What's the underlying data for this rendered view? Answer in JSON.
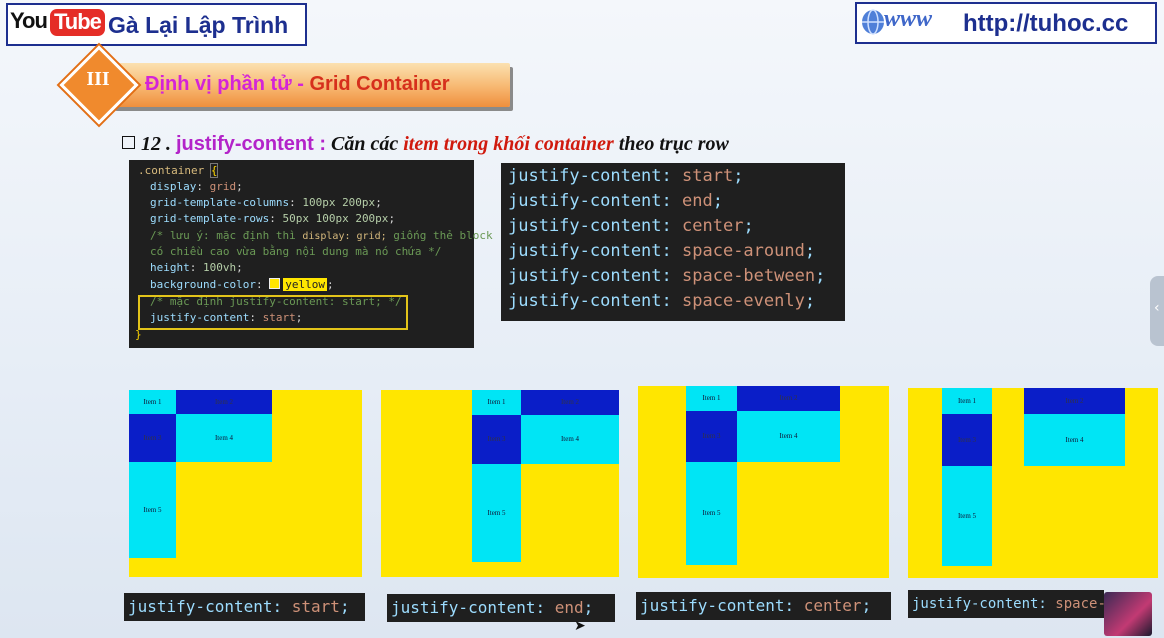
{
  "header": {
    "logo_you": "You",
    "logo_tube": "Tube",
    "channel_name": "Gà Lại Lập Trình",
    "site_www": "www",
    "site_url": "http://tuhoc.cc"
  },
  "section": {
    "roman": "III",
    "title_part1": "Định vị phần tử - ",
    "title_part2": "Grid Container"
  },
  "heading": {
    "number": "12 . ",
    "property": "justify-content :",
    "text1": " Căn các ",
    "emphasis": "item trong khối container",
    "text2": " theo trục row"
  },
  "code": {
    "selector": ".container",
    "brace_open": "{",
    "brace_close": "}",
    "lines": [
      {
        "prop": "display",
        "val": "grid"
      },
      {
        "prop": "grid-template-columns",
        "val": "100px 200px"
      },
      {
        "prop": "grid-template-rows",
        "val": "50px 100px 200px"
      }
    ],
    "comment1a": "/* lưu ý: mặc định thì ",
    "comment1b": "display: grid;",
    "comment1c": " giống thẻ block",
    "comment2": "có chiều cao vừa bằng nội dung mà nó chứa */",
    "height_prop": "height",
    "height_val": "100vh",
    "bg_prop": "background-color",
    "bg_val": "yellow",
    "comment3": "/* mặc định justify-content: start; */",
    "jc_prop": "justify-content",
    "jc_val": "start"
  },
  "values_list": {
    "prop": "justify-content",
    "items": [
      "start",
      "end",
      "center",
      "space-around",
      "space-between",
      "space-evenly"
    ]
  },
  "demos": [
    {
      "caption_val": "start",
      "items": [
        "Item 1",
        "Item 2",
        "Item 3",
        "Item 4",
        "Item 5"
      ]
    },
    {
      "caption_val": "end",
      "items": [
        "Item 1",
        "Item 2",
        "Item 3",
        "Item 4",
        "Item 5"
      ]
    },
    {
      "caption_val": "center",
      "items": [
        "Item 1",
        "Item 2",
        "Item 3",
        "Item 4",
        "Item 5"
      ]
    },
    {
      "caption_val": "space-ev",
      "items": [
        "Item 1",
        "Item 2",
        "Item 3",
        "Item 4",
        "Item 5"
      ]
    }
  ],
  "caption_prop": "justify-content:",
  "colors": {
    "container_bg": "#ffe600",
    "item_cyan": "#00e5f5",
    "item_blue": "#0a1ec8",
    "code_bg": "#1f1f1f",
    "accent_orange": "#f08a2d"
  }
}
